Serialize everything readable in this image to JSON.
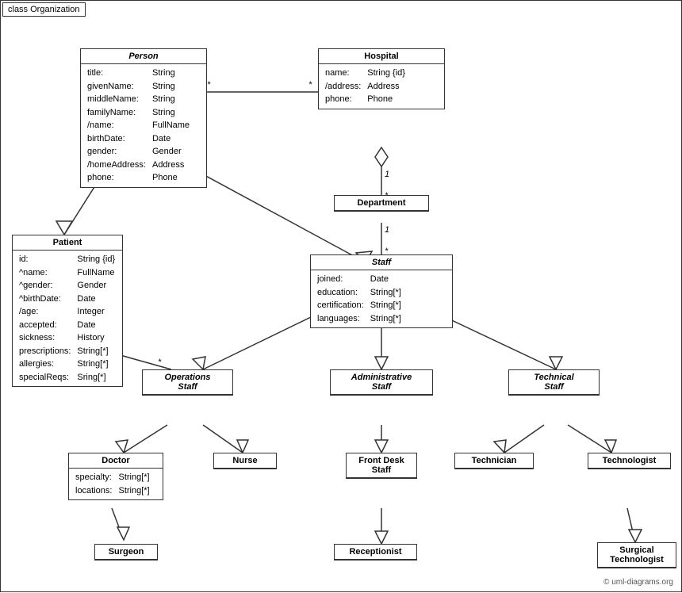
{
  "diagram": {
    "title": "class Organization",
    "copyright": "© uml-diagrams.org",
    "classes": {
      "person": {
        "name": "Person",
        "attrs": [
          [
            "title:",
            "String"
          ],
          [
            "givenName:",
            "String"
          ],
          [
            "middleName:",
            "String"
          ],
          [
            "familyName:",
            "String"
          ],
          [
            "/name:",
            "FullName"
          ],
          [
            "birthDate:",
            "Date"
          ],
          [
            "gender:",
            "Gender"
          ],
          [
            "/homeAddress:",
            "Address"
          ],
          [
            "phone:",
            "Phone"
          ]
        ]
      },
      "hospital": {
        "name": "Hospital",
        "attrs": [
          [
            "name:",
            "String {id}"
          ],
          [
            "/address:",
            "Address"
          ],
          [
            "phone:",
            "Phone"
          ]
        ]
      },
      "department": {
        "name": "Department",
        "attrs": []
      },
      "staff": {
        "name": "Staff",
        "attrs": [
          [
            "joined:",
            "Date"
          ],
          [
            "education:",
            "String[*]"
          ],
          [
            "certification:",
            "String[*]"
          ],
          [
            "languages:",
            "String[*]"
          ]
        ]
      },
      "patient": {
        "name": "Patient",
        "attrs": [
          [
            "id:",
            "String {id}"
          ],
          [
            "^name:",
            "FullName"
          ],
          [
            "^gender:",
            "Gender"
          ],
          [
            "^birthDate:",
            "Date"
          ],
          [
            "/age:",
            "Integer"
          ],
          [
            "accepted:",
            "Date"
          ],
          [
            "sickness:",
            "History"
          ],
          [
            "prescriptions:",
            "String[*]"
          ],
          [
            "allergies:",
            "String[*]"
          ],
          [
            "specialReqs:",
            "Sring[*]"
          ]
        ]
      },
      "operations_staff": {
        "name": "Operations\nStaff",
        "attrs": []
      },
      "administrative_staff": {
        "name": "Administrative\nStaff",
        "attrs": []
      },
      "technical_staff": {
        "name": "Technical\nStaff",
        "attrs": []
      },
      "doctor": {
        "name": "Doctor",
        "attrs": [
          [
            "specialty:",
            "String[*]"
          ],
          [
            "locations:",
            "String[*]"
          ]
        ]
      },
      "nurse": {
        "name": "Nurse",
        "attrs": []
      },
      "front_desk_staff": {
        "name": "Front Desk\nStaff",
        "attrs": []
      },
      "technician": {
        "name": "Technician",
        "attrs": []
      },
      "technologist": {
        "name": "Technologist",
        "attrs": []
      },
      "surgeon": {
        "name": "Surgeon",
        "attrs": []
      },
      "receptionist": {
        "name": "Receptionist",
        "attrs": []
      },
      "surgical_technologist": {
        "name": "Surgical\nTechnologist",
        "attrs": []
      }
    }
  }
}
